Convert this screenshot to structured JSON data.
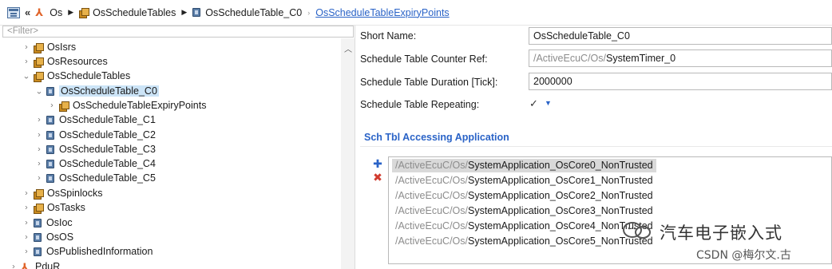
{
  "breadcrumb": {
    "back_glyph": "«",
    "items": [
      {
        "label": "Os",
        "kind": "module"
      },
      {
        "label": "OsScheduleTables",
        "kind": "container-group"
      },
      {
        "label": "OsScheduleTable_C0",
        "kind": "container"
      },
      {
        "label": "OsScheduleTableExpiryPoints",
        "kind": "link"
      }
    ]
  },
  "tree": {
    "filter_placeholder": "<Filter>",
    "nodes": [
      {
        "label": "OsIsrs",
        "icon": "module-icon",
        "expanded": false
      },
      {
        "label": "OsResources",
        "icon": "module-icon",
        "expanded": false
      },
      {
        "label": "OsScheduleTables",
        "icon": "module-icon",
        "expanded": true
      },
      {
        "label": "OsScheduleTable_C0",
        "icon": "container-icon",
        "expanded": true,
        "selected": true
      },
      {
        "label": "OsScheduleTableExpiryPoints",
        "icon": "module-icon",
        "expanded": false
      },
      {
        "label": "OsScheduleTable_C1",
        "icon": "container-icon",
        "expanded": false
      },
      {
        "label": "OsScheduleTable_C2",
        "icon": "container-icon",
        "expanded": false
      },
      {
        "label": "OsScheduleTable_C3",
        "icon": "container-icon",
        "expanded": false
      },
      {
        "label": "OsScheduleTable_C4",
        "icon": "container-icon",
        "expanded": false
      },
      {
        "label": "OsScheduleTable_C5",
        "icon": "container-icon",
        "expanded": false
      },
      {
        "label": "OsSpinlocks",
        "icon": "module-icon",
        "expanded": false
      },
      {
        "label": "OsTasks",
        "icon": "module-icon",
        "expanded": false
      },
      {
        "label": "OsIoc",
        "icon": "container-icon",
        "expanded": false
      },
      {
        "label": "OsOS",
        "icon": "container-icon",
        "expanded": false
      },
      {
        "label": "OsPublishedInformation",
        "icon": "container-icon",
        "expanded": false
      },
      {
        "label": "PduR",
        "icon": "os-module-icon",
        "expanded": false
      }
    ]
  },
  "form": {
    "short_name_label": "Short Name:",
    "short_name_value": "OsScheduleTable_C0",
    "counter_ref_label": "Schedule Table Counter Ref:",
    "counter_ref_prefix": "/ActiveEcuC/Os/",
    "counter_ref_value": "SystemTimer_0",
    "duration_label": "Schedule Table Duration [Tick]:",
    "duration_value": "2000000",
    "repeating_label": "Schedule Table Repeating:",
    "repeating_checked": true,
    "check_glyph": "✓",
    "dropdown_glyph": "▼",
    "section_title": "Sch Tbl Accessing Application",
    "add_glyph": "✚",
    "delete_glyph": "✖",
    "applications": [
      {
        "prefix": "/ActiveEcuC/Os/",
        "name": "SystemApplication_OsCore0_NonTrusted",
        "selected": true
      },
      {
        "prefix": "/ActiveEcuC/Os/",
        "name": "SystemApplication_OsCore1_NonTrusted",
        "selected": false
      },
      {
        "prefix": "/ActiveEcuC/Os/",
        "name": "SystemApplication_OsCore2_NonTrusted",
        "selected": false
      },
      {
        "prefix": "/ActiveEcuC/Os/",
        "name": "SystemApplication_OsCore3_NonTrusted",
        "selected": false
      },
      {
        "prefix": "/ActiveEcuC/Os/",
        "name": "SystemApplication_OsCore4_NonTrusted",
        "selected": false
      },
      {
        "prefix": "/ActiveEcuC/Os/",
        "name": "SystemApplication_OsCore5_NonTrusted",
        "selected": false
      }
    ]
  },
  "watermark": {
    "title": "汽车电子嵌入式",
    "subtitle": "CSDN @梅尔文.古"
  },
  "colors": {
    "link_blue": "#2a63c7",
    "selection_blue": "#cce4f7",
    "module_orange": "#e7b14a",
    "delete_red": "#d13b2e"
  }
}
